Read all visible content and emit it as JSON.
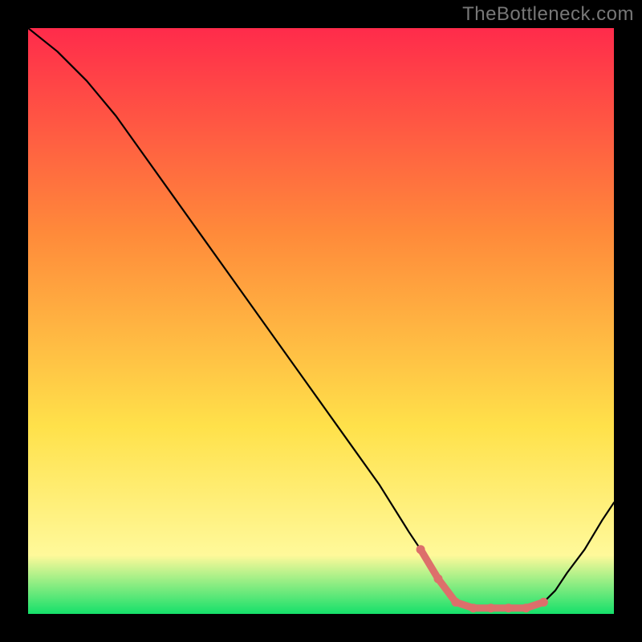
{
  "watermark": "TheBottleneck.com",
  "colors": {
    "page_bg": "#000000",
    "grad_top": "#ff2b4b",
    "grad_mid1": "#ff8a3a",
    "grad_mid2": "#ffe14a",
    "grad_low": "#fff99a",
    "grad_bottom": "#15e06a",
    "curve": "#000000",
    "accent": "#dd6f6b",
    "watermark": "#777777"
  },
  "chart_data": {
    "type": "line",
    "title": "",
    "xlabel": "",
    "ylabel": "",
    "xlim": [
      0,
      100
    ],
    "ylim": [
      0,
      100
    ],
    "legend": false,
    "grid": false,
    "series": [
      {
        "name": "curve",
        "x": [
          0,
          5,
          10,
          15,
          20,
          25,
          30,
          35,
          40,
          45,
          50,
          55,
          60,
          65,
          67,
          70,
          73,
          76,
          79,
          82,
          85,
          88,
          90,
          92,
          95,
          98,
          100
        ],
        "values": [
          100,
          96,
          91,
          85,
          78,
          71,
          64,
          57,
          50,
          43,
          36,
          29,
          22,
          14,
          11,
          6,
          2,
          1,
          1,
          1,
          1,
          2,
          4,
          7,
          11,
          16,
          19
        ]
      }
    ],
    "accent_region": {
      "name": "trough-points",
      "x": [
        67,
        70,
        73,
        76,
        79,
        82,
        85,
        88
      ],
      "values": [
        11,
        6,
        2,
        1,
        1,
        1,
        1,
        2
      ]
    }
  }
}
